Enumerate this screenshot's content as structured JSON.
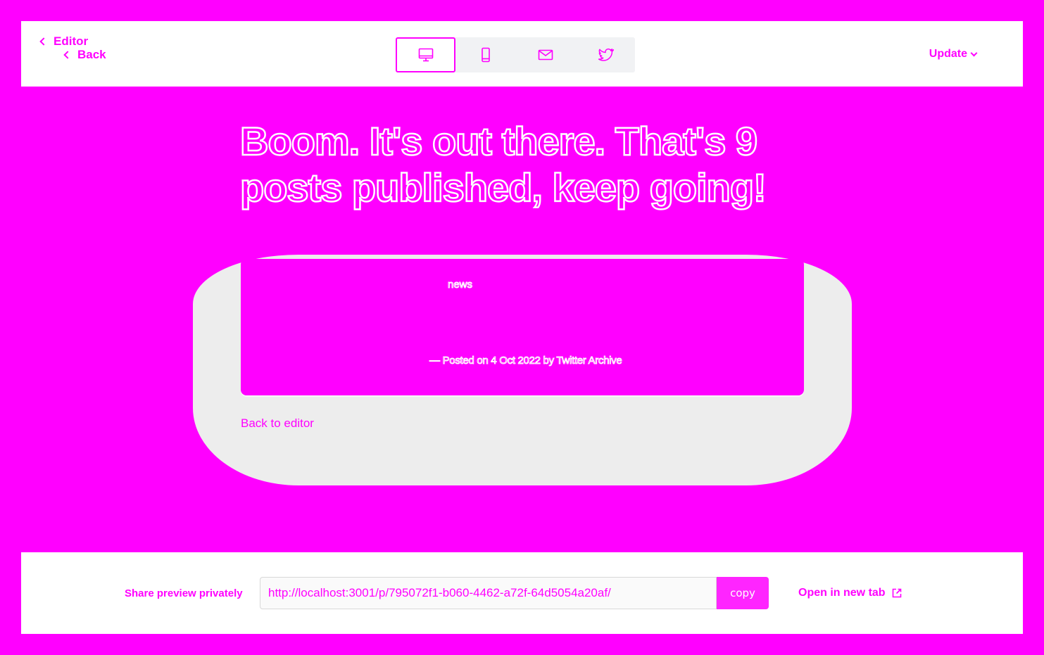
{
  "header": {
    "crumb_primary": "Editor",
    "crumb_back": "Back",
    "update_label": "Update",
    "preview_modes": [
      {
        "name": "desktop",
        "icon": "desktop-icon",
        "active": true
      },
      {
        "name": "mobile",
        "icon": "mobile-icon",
        "active": false
      },
      {
        "name": "email",
        "icon": "email-icon",
        "active": false
      },
      {
        "name": "twitter",
        "icon": "twitter-icon",
        "active": false
      }
    ]
  },
  "main": {
    "headline": "Boom. It's out there. That's 9 posts published, keep going!",
    "card": {
      "tag": "news",
      "meta": "— Posted on 4 Oct 2022 by Twitter Archive"
    },
    "back_to_editor": "Back to editor"
  },
  "footer": {
    "share_label": "Share preview privately",
    "url_value": "http://localhost:3001/p/795072f1-b060-4462-a72f-64d5054a20af/",
    "copy_label": "copy",
    "open_new_tab_label": "Open in new tab"
  },
  "colors": {
    "accent": "#ff00ff",
    "surface": "#ffffff",
    "blob": "#ededed"
  }
}
